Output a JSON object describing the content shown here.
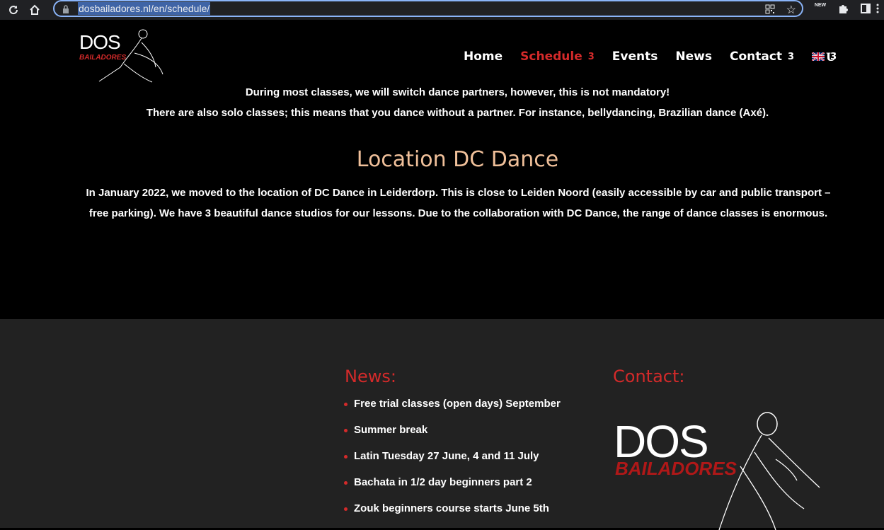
{
  "browser": {
    "url": "dosbailadores.nl/en/schedule/",
    "ext_new_label": "NEW"
  },
  "header": {
    "logo_dos": "DOS",
    "logo_bailadores": "BAILADORES",
    "nav": [
      {
        "label": "Home",
        "caret": ""
      },
      {
        "label": "Schedule",
        "caret": "3"
      },
      {
        "label": "Events",
        "caret": ""
      },
      {
        "label": "News",
        "caret": ""
      },
      {
        "label": "Contact",
        "caret": "3"
      }
    ],
    "lang_caret": "3",
    "search_glyph": "U"
  },
  "content": {
    "para1": "During most classes, we will switch dance partners, however, this is not mandatory!",
    "para2": "There are also solo classes; this means that you dance without a partner. For instance, bellydancing, Brazilian dance (Axé).",
    "location_title": "Location DC Dance",
    "location_text": "In January 2022, we moved to the location of DC Dance in Leiderdorp. This is close to Leiden Noord (easily accessible by car and public transport – free parking). We have 3 beautiful dance studios for our lessons. Due to the collaboration with DC Dance, the range of dance classes is enormous."
  },
  "footer": {
    "news_title": "News:",
    "news_items": [
      "Free trial classes (open days) September",
      "Summer break",
      "Latin Tuesday 27 June, 4 and 11 July",
      "Bachata in 1/2 day beginners part 2",
      "Zouk beginners course starts June 5th"
    ],
    "contact_title": "Contact:",
    "logo_dos": "DOS",
    "logo_bailadores": "BAILADORES"
  },
  "colors": {
    "accent_red": "#d42a2a",
    "title_peach": "#f0c09a",
    "footer_bg": "#222222"
  }
}
